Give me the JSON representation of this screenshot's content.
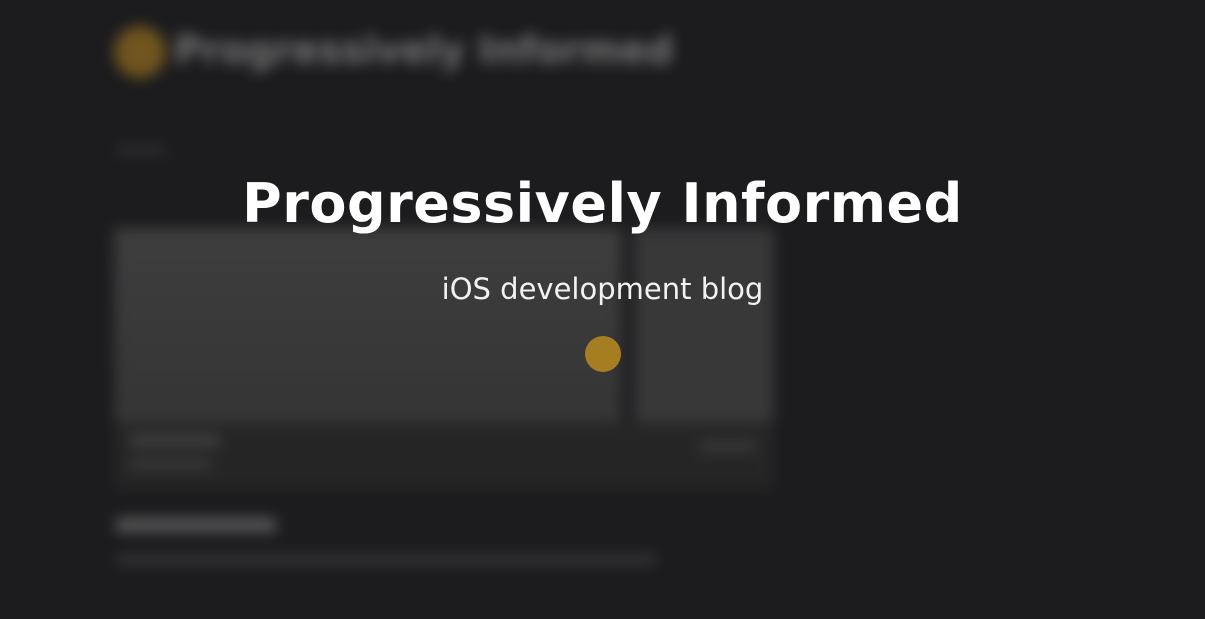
{
  "splash": {
    "title": "Progressively Informed",
    "subtitle": "iOS development blog",
    "indicator_icon": "loading-dot-icon",
    "accent_color": "#a57e22"
  },
  "background_page": {
    "site_title": "Progressively Informed",
    "logo_icon": "logo-dot-icon",
    "logo_color": "#b58420"
  },
  "colors": {
    "background": "#1c1c1e",
    "title_text": "#ffffff"
  }
}
